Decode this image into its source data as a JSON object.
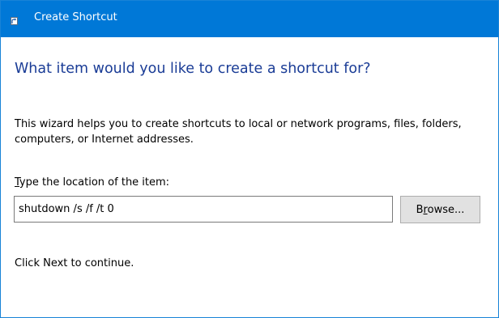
{
  "window": {
    "title": "Create Shortcut",
    "accent_color": "#0078d7"
  },
  "wizard": {
    "heading": "What item would you like to create a shortcut for?",
    "description": "This wizard helps you to create shortcuts to local or network programs, files, folders, computers, or Internet addresses.",
    "location_label_accesskey": "T",
    "location_label_rest": "ype the location of the item:",
    "location_value": "shutdown /s /f /t 0",
    "browse_label_prefix": "B",
    "browse_label_accesskey": "r",
    "browse_label_rest": "owse...",
    "footer": "Click Next to continue.",
    "heading_color": "#1a3c96"
  },
  "icons": {
    "app_icon": "shortcut-arrow-icon"
  }
}
